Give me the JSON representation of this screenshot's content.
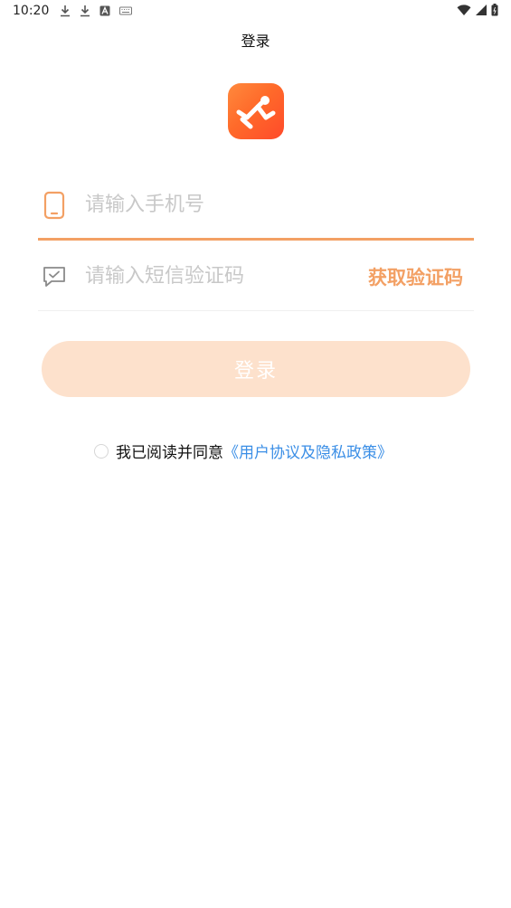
{
  "status_bar": {
    "time": "10:20",
    "left_icons": [
      "download-icon",
      "download-icon",
      "app-a-icon",
      "keyboard-icon"
    ],
    "right_icons": [
      "wifi-icon",
      "signal-icon",
      "battery-icon"
    ]
  },
  "header": {
    "title": "登录"
  },
  "logo": {
    "icon": "running-man-logo-icon",
    "gradient": [
      "#ff8a3d",
      "#ff4a2a"
    ]
  },
  "phone_field": {
    "icon": "phone-icon",
    "placeholder": "请输入手机号",
    "value": ""
  },
  "code_field": {
    "icon": "message-check-icon",
    "placeholder": "请输入短信验证码",
    "value": "",
    "get_code_label": "获取验证码"
  },
  "login_button": {
    "label": "登录"
  },
  "agreement": {
    "checked": false,
    "text": "我已阅读并同意",
    "link": "《用户协议及隐私政策》"
  },
  "colors": {
    "accent": "#f3a064",
    "button_bg": "#fde1cc",
    "link": "#3a8ee6"
  }
}
